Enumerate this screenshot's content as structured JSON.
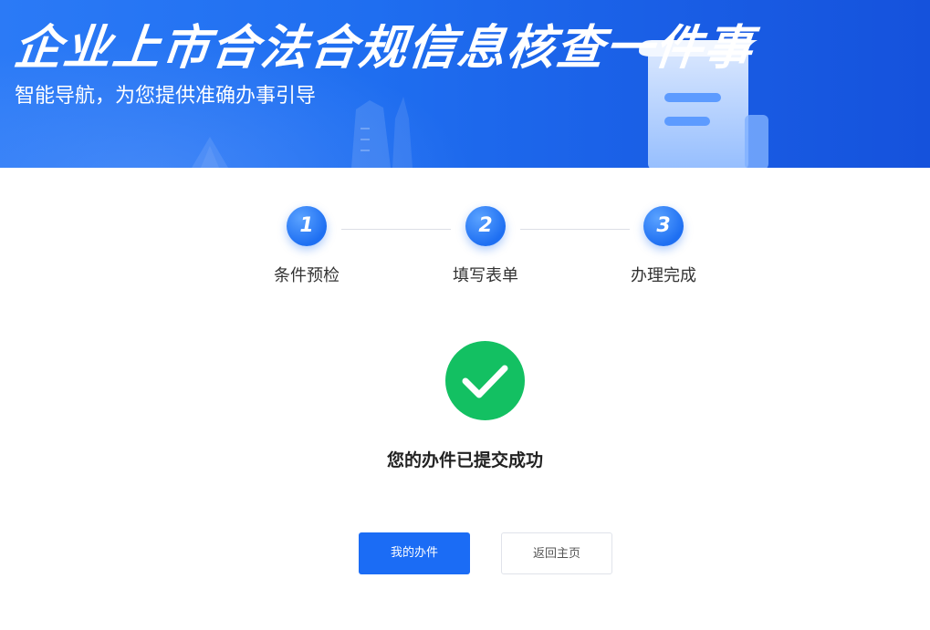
{
  "banner": {
    "title": "企业上市合法合规信息核查一件事",
    "subtitle": "智能导航，为您提供准确办事引导"
  },
  "steps": [
    {
      "number": "1",
      "label": "条件预检"
    },
    {
      "number": "2",
      "label": "填写表单"
    },
    {
      "number": "3",
      "label": "办理完成"
    }
  ],
  "result": {
    "message": "您的办件已提交成功"
  },
  "actions": {
    "my_items_label": "我的办件",
    "home_label": "返回主页"
  },
  "colors": {
    "primary": "#1b6cf5",
    "success": "#13c062",
    "banner": "#1f6ef0"
  }
}
